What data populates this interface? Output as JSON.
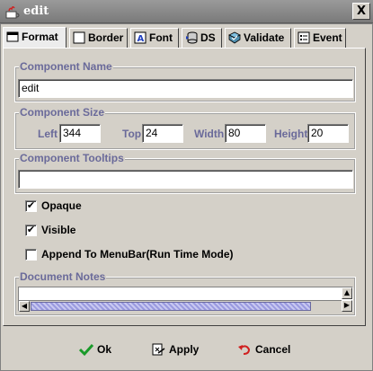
{
  "window": {
    "title": "edit",
    "close_symbol": "X"
  },
  "tabs": [
    {
      "label": "Format",
      "icon": "format-icon",
      "active": true
    },
    {
      "label": "Border",
      "icon": "border-icon",
      "active": false
    },
    {
      "label": "Font",
      "icon": "font-icon",
      "active": false
    },
    {
      "label": "DS",
      "icon": "datasource-icon",
      "active": false
    },
    {
      "label": "Validate",
      "icon": "validate-icon",
      "active": false
    },
    {
      "label": "Event",
      "icon": "event-icon",
      "active": false
    }
  ],
  "component_name": {
    "legend": "Component Name",
    "value": "edit"
  },
  "component_size": {
    "legend": "Component Size",
    "left_label": "Left",
    "left_value": "344",
    "top_label": "Top",
    "top_value": "24",
    "width_label": "Width",
    "width_value": "80",
    "height_label": "Height",
    "height_value": "20"
  },
  "component_tooltips": {
    "legend": "Component Tooltips",
    "value": ""
  },
  "options": [
    {
      "label": "Opaque",
      "checked": true,
      "mark": "✔"
    },
    {
      "label": "Visible",
      "checked": true,
      "mark": "✔"
    },
    {
      "label": "Append To MenuBar(Run Time Mode)",
      "checked": false,
      "mark": ""
    }
  ],
  "document_notes": {
    "legend": "Document Notes",
    "value": ""
  },
  "footer": {
    "ok_label": "Ok",
    "apply_label": "Apply",
    "cancel_label": "Cancel"
  },
  "colors": {
    "legend_text": "#6a6a9a",
    "dialog_bg": "#d4d0c8",
    "title_bar": "#7a7a7a"
  }
}
